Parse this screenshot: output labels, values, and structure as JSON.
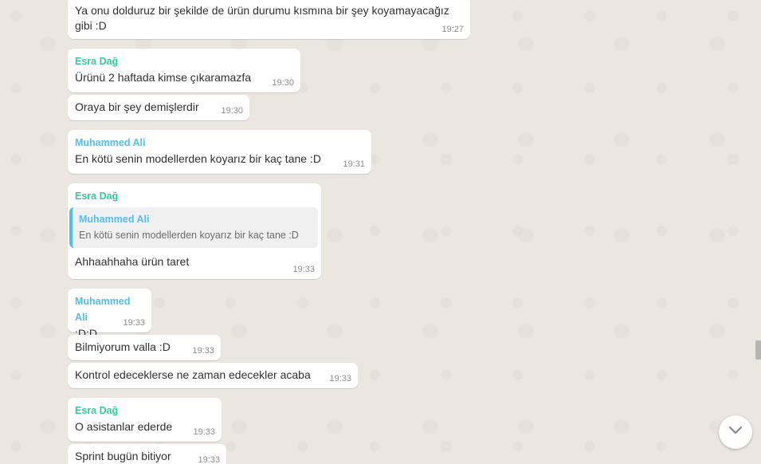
{
  "messages": [
    {
      "sender": "",
      "text": "Ya onu dolduruz bir şekilde de ürün durumu kısmına bir şey koyamayacağız gibi :D",
      "time": "19:27"
    },
    {
      "sender": "Esra Dağ",
      "text": "Ürünü 2 haftada kimse çıkaramazfa",
      "time": "19:30"
    },
    {
      "sender": "",
      "text": "Oraya bir şey demişlerdir",
      "time": "19:30"
    },
    {
      "sender": "Muhammed Ali",
      "text": "En kötü senin modellerden koyarız bir kaç tane :D",
      "time": "19:31"
    },
    {
      "sender": "Esra Dağ",
      "quote_author": "Muhammed Ali",
      "quote_text": "En kötü senin modellerden koyarız bir kaç tane :D",
      "text": "Ahhaahhaha ürün taret",
      "time": "19:33"
    },
    {
      "sender": "Muhammed Ali",
      "text": ":D:D",
      "time": "19:33"
    },
    {
      "sender": "",
      "text": "Bilmiyorum valla :D",
      "time": "19:33"
    },
    {
      "sender": "",
      "text": "Kontrol edeceklerse ne zaman edecekler acaba",
      "time": "19:33"
    },
    {
      "sender": "Esra Dağ",
      "text": "O asistanlar ederde",
      "time": "19:33"
    },
    {
      "sender": "",
      "text": "Sprint bugün bitiyor",
      "time": "19:33"
    }
  ],
  "icons": {
    "scroll_down": "chevron-down-icon"
  },
  "colors": {
    "background": "#ebe6df",
    "bubble": "#ffffff",
    "esra_name": "#35cd96",
    "ali_name": "#53bdeb",
    "timestamp": "#8c8c8c"
  }
}
